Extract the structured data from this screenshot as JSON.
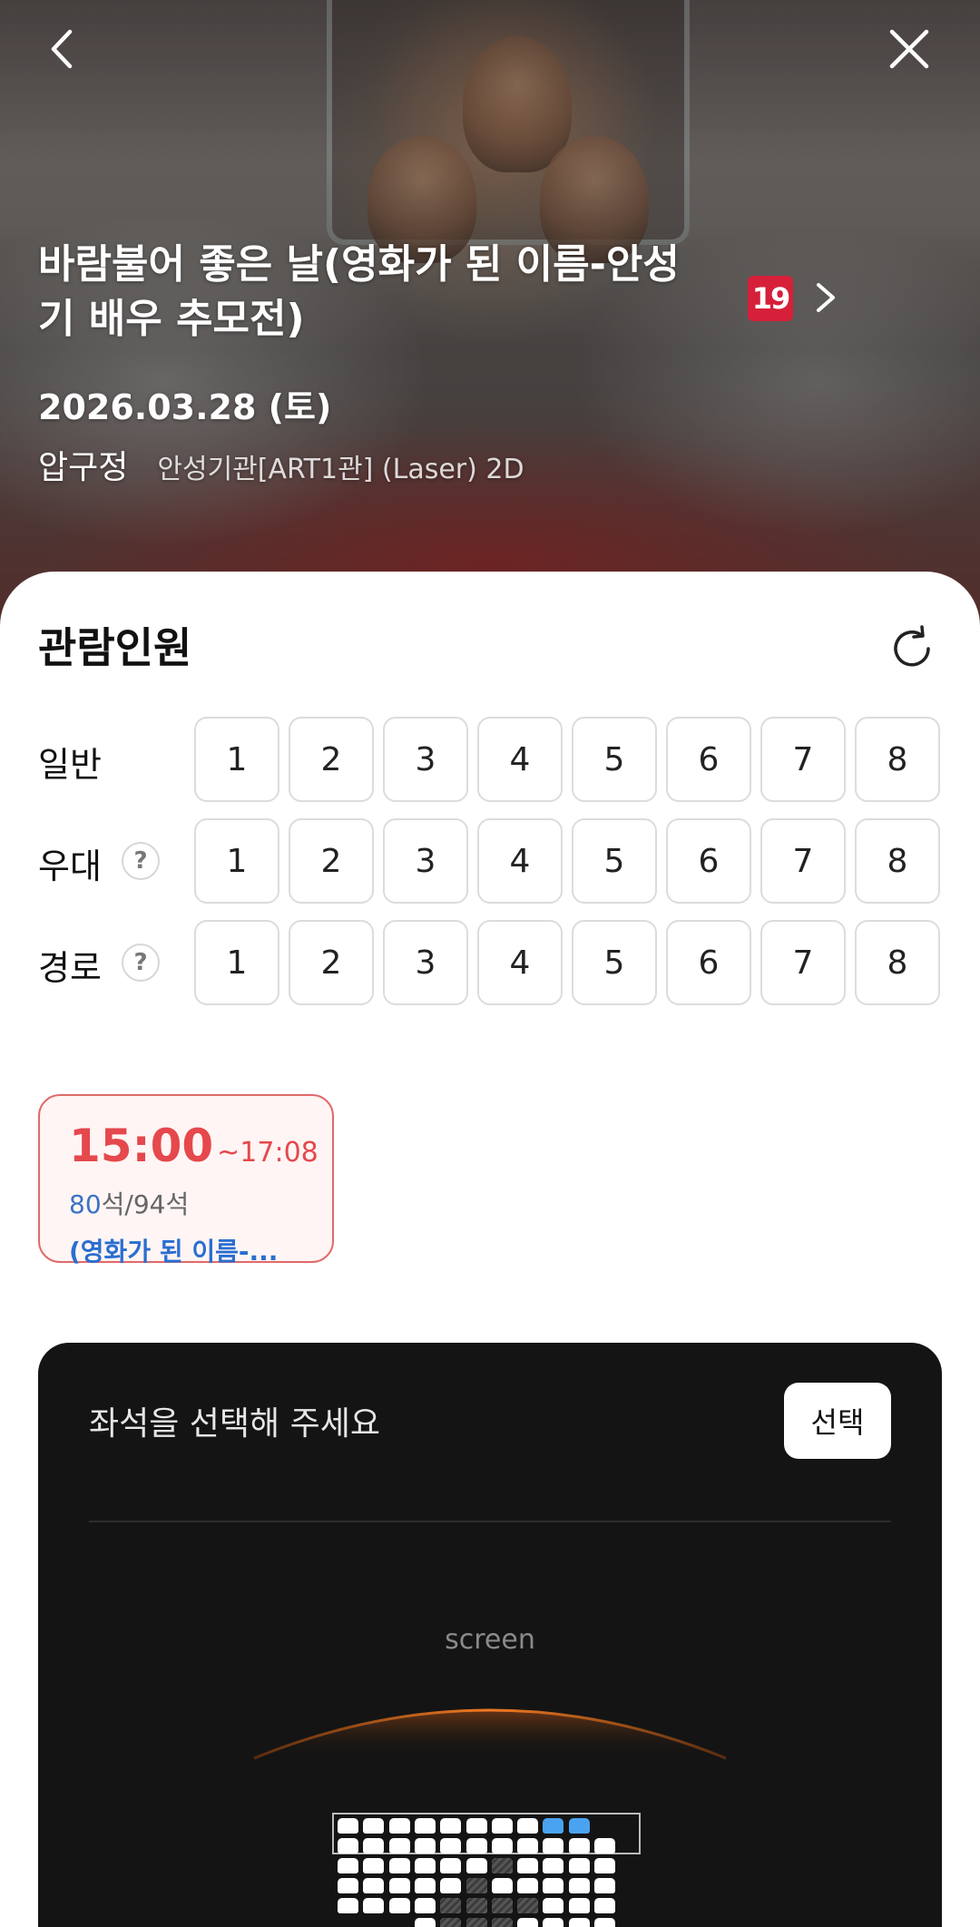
{
  "header": {
    "back_icon": "chevron-left-icon",
    "close_icon": "close-icon"
  },
  "movie": {
    "title": "바람불어 좋은 날(영화가 된 이름-안성기 배우 추모전)",
    "rating": "19",
    "date": "2026.03.28 (토)",
    "location": "압구정",
    "hall": "안성기관[ART1관] (Laser) 2D"
  },
  "audience": {
    "title": "관람인원",
    "refresh_icon": "refresh-icon",
    "rows": [
      {
        "label": "일반",
        "help": false,
        "numbers": [
          "1",
          "2",
          "3",
          "4",
          "5",
          "6",
          "7",
          "8"
        ]
      },
      {
        "label": "우대",
        "help": true,
        "help_glyph": "?",
        "numbers": [
          "1",
          "2",
          "3",
          "4",
          "5",
          "6",
          "7",
          "8"
        ]
      },
      {
        "label": "경로",
        "help": true,
        "help_glyph": "?",
        "numbers": [
          "1",
          "2",
          "3",
          "4",
          "5",
          "6",
          "7",
          "8"
        ]
      }
    ]
  },
  "showtime": {
    "start": "15:00",
    "end": "~17:08",
    "seats_available": "80",
    "seats_total_text": "석/94석",
    "movie_short": "(영화가 된 이름-..."
  },
  "seat_panel": {
    "prompt": "좌석을 선택해 주세요",
    "select_label": "선택",
    "screen_label": "screen",
    "selected_color": "#4aa3f0",
    "rows": [
      "AAAAAAAASS.",
      "AAAAAAAAAAA",
      "AAAAAAAAAAA",
      "AAAAAAAAAAA",
      "AAAAAAAAAAA",
      "...AAAAAAAA"
    ]
  }
}
